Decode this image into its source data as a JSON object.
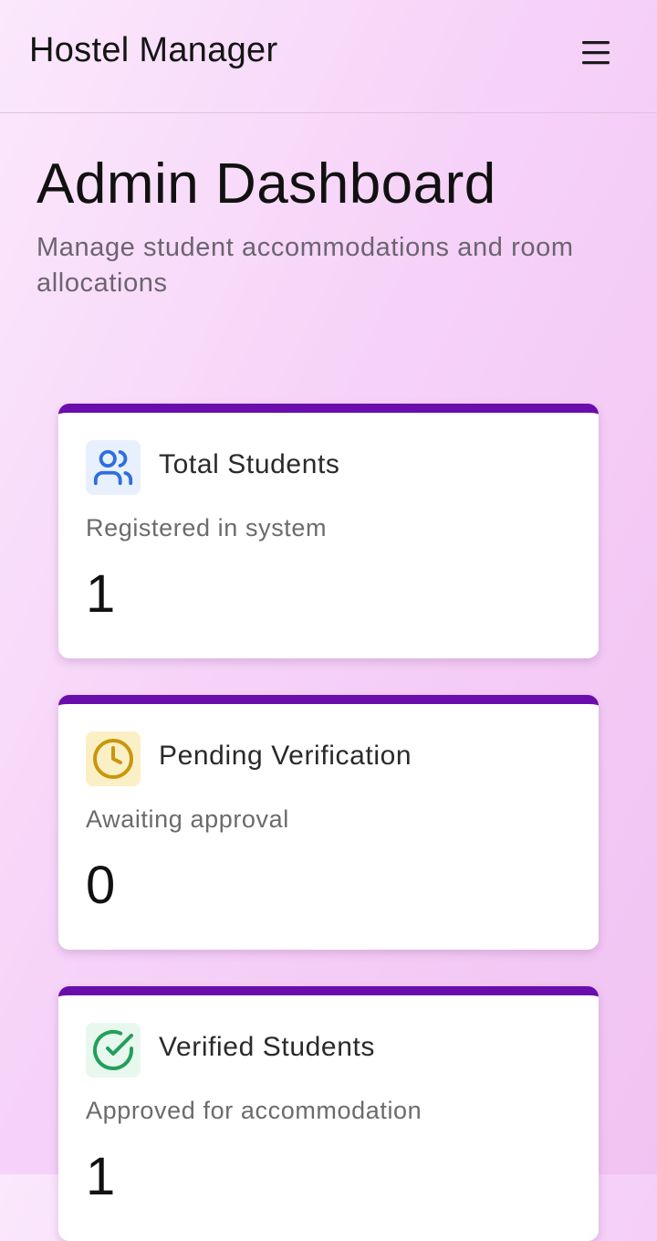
{
  "header": {
    "app_title": "Hostel Manager",
    "menu_icon": "hamburger-menu-icon"
  },
  "page": {
    "title": "Admin Dashboard",
    "subtitle": "Manage student accommodations and room allocations"
  },
  "colors": {
    "accent": "#6a0dad",
    "blue_icon": "#2d6fe0",
    "yellow_icon": "#c9960c",
    "green_icon": "#22a05a"
  },
  "cards": [
    {
      "title": "Total Students",
      "description": "Registered in system",
      "value": "1",
      "icon": "users-icon"
    },
    {
      "title": "Pending Verification",
      "description": "Awaiting approval",
      "value": "0",
      "icon": "clock-icon"
    },
    {
      "title": "Verified Students",
      "description": "Approved for accommodation",
      "value": "1",
      "icon": "check-circle-icon"
    }
  ]
}
